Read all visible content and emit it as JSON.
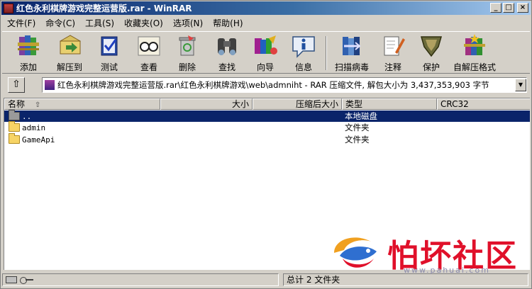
{
  "window": {
    "title": "红色永利棋牌游戏完整运营版.rar - WinRAR",
    "minimize": "_",
    "maximize": "□",
    "close": "×"
  },
  "menu": [
    "文件(F)",
    "命令(C)",
    "工具(S)",
    "收藏夹(O)",
    "选项(N)",
    "帮助(H)"
  ],
  "toolbar": {
    "add": "添加",
    "extract_to": "解压到",
    "test": "测试",
    "view": "查看",
    "delete": "删除",
    "find": "查找",
    "wizard": "向导",
    "info": "信息",
    "virus_scan": "扫描病毒",
    "comment": "注释",
    "protect": "保护",
    "sfx": "自解压格式"
  },
  "address": {
    "up": "⇧",
    "path": "红色永利棋牌游戏完整运营版.rar\\红色永利棋牌游戏\\web\\admniht - RAR 压缩文件, 解包大小为 3,437,353,903 字节",
    "dropdown": "▼"
  },
  "columns": {
    "name": "名称",
    "sort_indicator": "⇧",
    "size": "大小",
    "packed": "压缩后大小",
    "type": "类型",
    "crc": "CRC32"
  },
  "files": [
    {
      "name": "..",
      "type": "本地磁盘",
      "selected": true
    },
    {
      "name": "admin",
      "type": "文件夹",
      "selected": false
    },
    {
      "name": "GameApi",
      "type": "文件夹",
      "selected": false
    }
  ],
  "status": {
    "total": "总计 2 文件夹"
  },
  "watermark": {
    "text": "怕坏社区",
    "url": "www.pahuai.com"
  },
  "colors": {
    "selection": "#0a246a",
    "titlebar": "#0a246a",
    "watermark": "#e0102a"
  }
}
